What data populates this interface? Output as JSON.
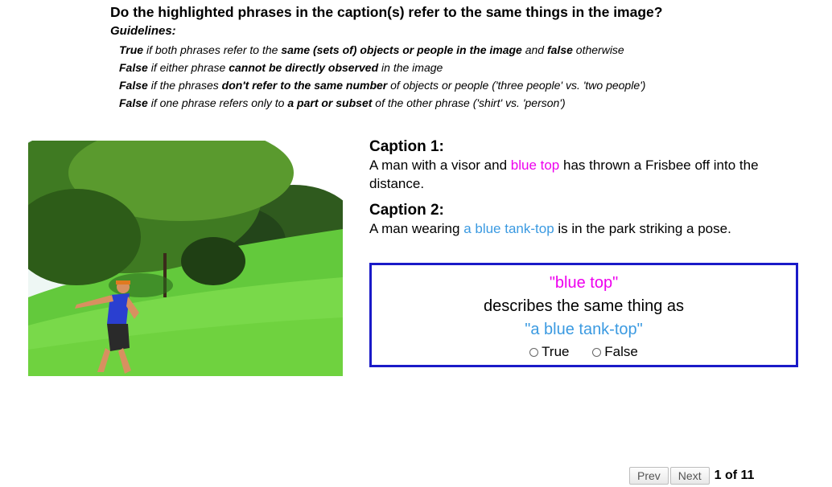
{
  "question": "Do the highlighted phrases in the caption(s) refer to the same things in the image?",
  "guidelines": {
    "title": "Guidelines:",
    "rules": [
      {
        "lead": "True",
        "a": " if both phrases refer to the ",
        "b": "same (sets of) objects or people in the image",
        "c": " and ",
        "d": "false",
        "e": " otherwise"
      },
      {
        "lead": "False",
        "a": " if either phrase ",
        "b": "cannot be directly observed",
        "c": " in the image",
        "d": "",
        "e": ""
      },
      {
        "lead": "False",
        "a": " if the phrases ",
        "b": "don't refer to the same number",
        "c": " of objects or people ('three people' vs. 'two people')",
        "d": "",
        "e": ""
      },
      {
        "lead": "False",
        "a": " if one phrase refers only to ",
        "b": "a part or subset",
        "c": " of the other phrase ('shirt' vs. 'person')",
        "d": "",
        "e": ""
      }
    ]
  },
  "captions": [
    {
      "title": "Caption 1:",
      "before": "A man with a visor and ",
      "highlight": "blue top",
      "after": " has thrown a Frisbee off into the distance.",
      "highlight_color": "#ee00ee"
    },
    {
      "title": "Caption 2:",
      "before": "A man wearing ",
      "highlight": "a blue tank-top",
      "after": " is in the park striking a pose.",
      "highlight_color": "#3b9ae1"
    }
  ],
  "answer": {
    "phrase1": "\"blue top\"",
    "middle": "describes the same thing as",
    "phrase2": "\"a blue tank-top\"",
    "options": [
      "True",
      "False"
    ],
    "border_color": "#1a1ac8"
  },
  "pager": {
    "prev": "Prev",
    "next": "Next",
    "count": "1 of 11"
  },
  "image": {
    "subject": "man in blue tank top and visor throwing a frisbee in a sunny park with trees"
  }
}
